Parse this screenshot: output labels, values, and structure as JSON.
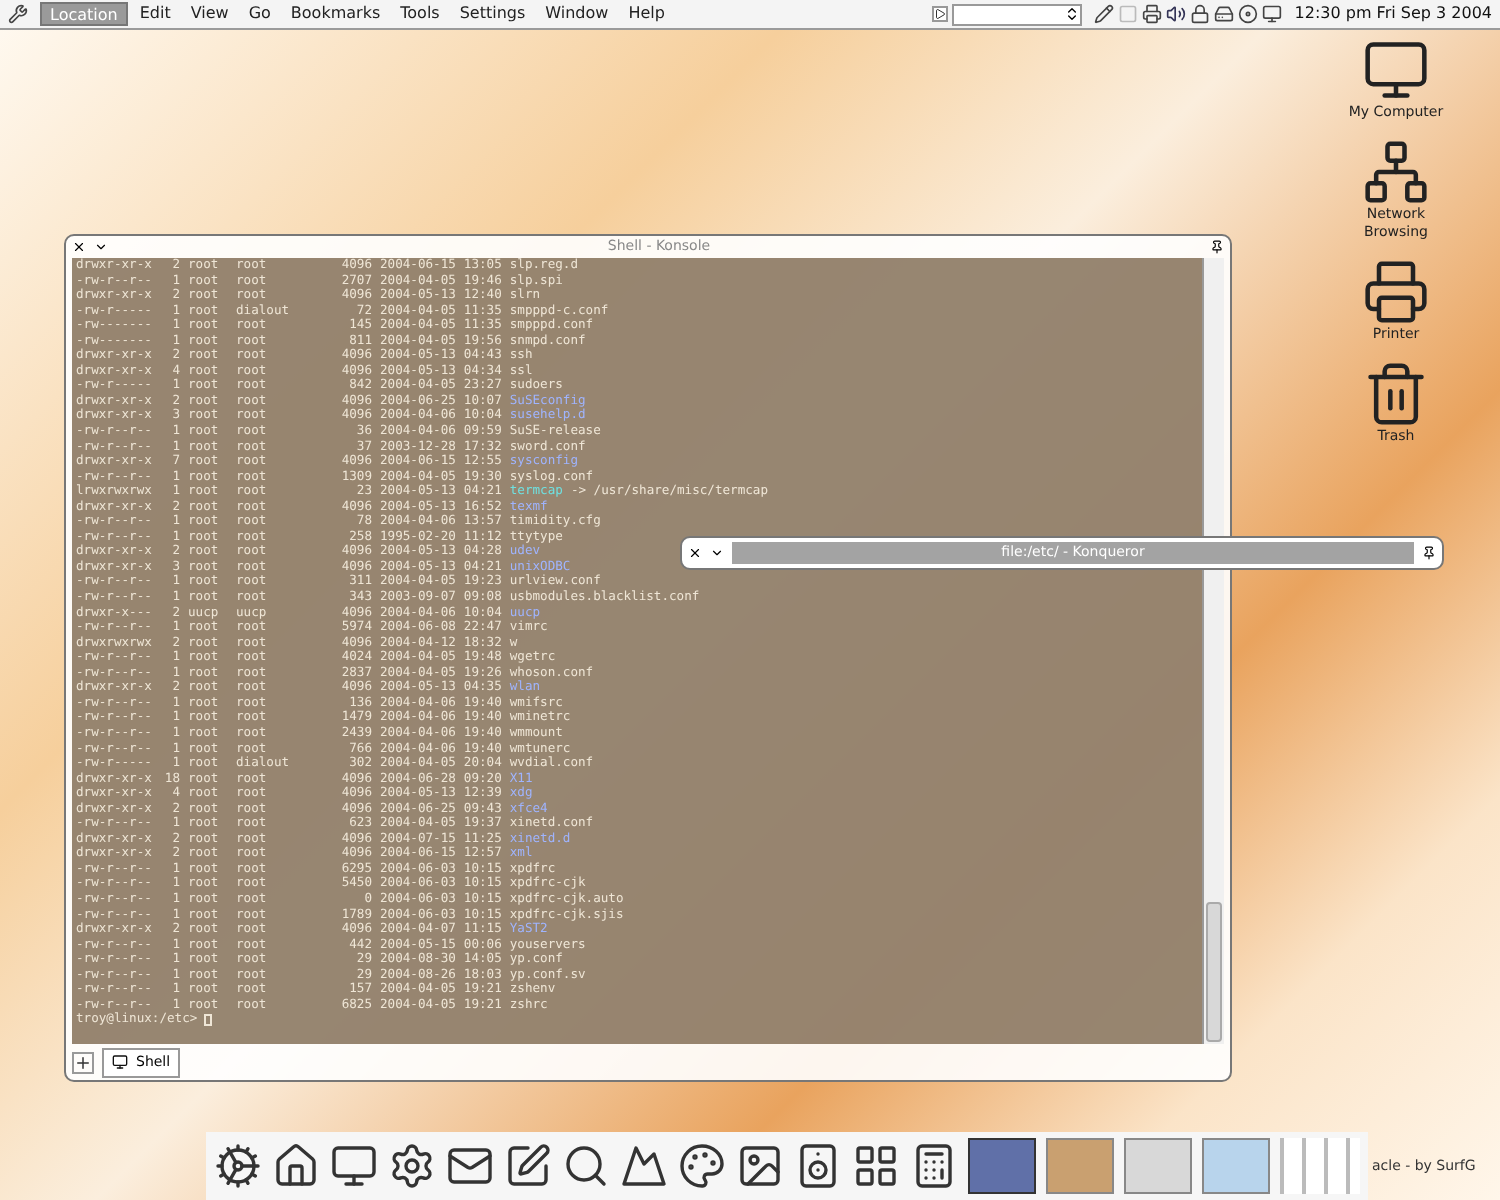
{
  "menubar": {
    "menus": [
      {
        "label": "Location",
        "selected": true
      },
      {
        "label": "Edit",
        "selected": false
      },
      {
        "label": "View",
        "selected": false
      },
      {
        "label": "Go",
        "selected": false
      },
      {
        "label": "Bookmarks",
        "selected": false
      },
      {
        "label": "Tools",
        "selected": false
      },
      {
        "label": "Settings",
        "selected": false
      },
      {
        "label": "Window",
        "selected": false
      },
      {
        "label": "Help",
        "selected": false
      }
    ],
    "clock": "12:30 pm Fri Sep 3 2004"
  },
  "desktop_icons": [
    {
      "label": "My Computer",
      "kind": "computer"
    },
    {
      "label": "Network Browsing",
      "kind": "network"
    },
    {
      "label": "Printer",
      "kind": "printer"
    },
    {
      "label": "Trash",
      "kind": "trash"
    }
  ],
  "shell_window": {
    "title": "Shell - Konsole",
    "listing": [
      {
        "perms": "drwxr-xr-x",
        "links": "2",
        "owner": "root",
        "group": "root",
        "size": "4096",
        "date": "2004-06-15",
        "time": "13:05",
        "name": "slp.reg.d",
        "kind": "file"
      },
      {
        "perms": "-rw-r--r--",
        "links": "1",
        "owner": "root",
        "group": "root",
        "size": "2707",
        "date": "2004-04-05",
        "time": "19:46",
        "name": "slp.spi",
        "kind": "file"
      },
      {
        "perms": "drwxr-xr-x",
        "links": "2",
        "owner": "root",
        "group": "root",
        "size": "4096",
        "date": "2004-05-13",
        "time": "12:40",
        "name": "slrn",
        "kind": "file"
      },
      {
        "perms": "-rw-r-----",
        "links": "1",
        "owner": "root",
        "group": "dialout",
        "size": "72",
        "date": "2004-04-05",
        "time": "11:35",
        "name": "smpppd-c.conf",
        "kind": "file"
      },
      {
        "perms": "-rw-------",
        "links": "1",
        "owner": "root",
        "group": "root",
        "size": "145",
        "date": "2004-04-05",
        "time": "11:35",
        "name": "smpppd.conf",
        "kind": "file"
      },
      {
        "perms": "-rw-------",
        "links": "1",
        "owner": "root",
        "group": "root",
        "size": "811",
        "date": "2004-04-05",
        "time": "19:56",
        "name": "snmpd.conf",
        "kind": "file"
      },
      {
        "perms": "drwxr-xr-x",
        "links": "2",
        "owner": "root",
        "group": "root",
        "size": "4096",
        "date": "2004-05-13",
        "time": "04:43",
        "name": "ssh",
        "kind": "file"
      },
      {
        "perms": "drwxr-xr-x",
        "links": "4",
        "owner": "root",
        "group": "root",
        "size": "4096",
        "date": "2004-05-13",
        "time": "04:34",
        "name": "ssl",
        "kind": "file"
      },
      {
        "perms": "-rw-r-----",
        "links": "1",
        "owner": "root",
        "group": "root",
        "size": "842",
        "date": "2004-04-05",
        "time": "23:27",
        "name": "sudoers",
        "kind": "file"
      },
      {
        "perms": "drwxr-xr-x",
        "links": "2",
        "owner": "root",
        "group": "root",
        "size": "4096",
        "date": "2004-06-25",
        "time": "10:07",
        "name": "SuSEconfig",
        "kind": "dir"
      },
      {
        "perms": "drwxr-xr-x",
        "links": "3",
        "owner": "root",
        "group": "root",
        "size": "4096",
        "date": "2004-04-06",
        "time": "10:04",
        "name": "susehelp.d",
        "kind": "dir"
      },
      {
        "perms": "-rw-r--r--",
        "links": "1",
        "owner": "root",
        "group": "root",
        "size": "36",
        "date": "2004-04-06",
        "time": "09:59",
        "name": "SuSE-release",
        "kind": "file"
      },
      {
        "perms": "-rw-r--r--",
        "links": "1",
        "owner": "root",
        "group": "root",
        "size": "37",
        "date": "2003-12-28",
        "time": "17:32",
        "name": "sword.conf",
        "kind": "file"
      },
      {
        "perms": "drwxr-xr-x",
        "links": "7",
        "owner": "root",
        "group": "root",
        "size": "4096",
        "date": "2004-06-15",
        "time": "12:55",
        "name": "sysconfig",
        "kind": "dir"
      },
      {
        "perms": "-rw-r--r--",
        "links": "1",
        "owner": "root",
        "group": "root",
        "size": "1309",
        "date": "2004-04-05",
        "time": "19:30",
        "name": "syslog.conf",
        "kind": "file"
      },
      {
        "perms": "lrwxrwxrwx",
        "links": "1",
        "owner": "root",
        "group": "root",
        "size": "23",
        "date": "2004-05-13",
        "time": "04:21",
        "name": "termcap",
        "target": "-> /usr/share/misc/termcap",
        "kind": "link"
      },
      {
        "perms": "drwxr-xr-x",
        "links": "2",
        "owner": "root",
        "group": "root",
        "size": "4096",
        "date": "2004-05-13",
        "time": "16:52",
        "name": "texmf",
        "kind": "dir"
      },
      {
        "perms": "-rw-r--r--",
        "links": "1",
        "owner": "root",
        "group": "root",
        "size": "78",
        "date": "2004-04-06",
        "time": "13:57",
        "name": "timidity.cfg",
        "kind": "file"
      },
      {
        "perms": "-rw-r--r--",
        "links": "1",
        "owner": "root",
        "group": "root",
        "size": "258",
        "date": "1995-02-20",
        "time": "11:12",
        "name": "ttytype",
        "kind": "file"
      },
      {
        "perms": "drwxr-xr-x",
        "links": "2",
        "owner": "root",
        "group": "root",
        "size": "4096",
        "date": "2004-05-13",
        "time": "04:28",
        "name": "udev",
        "kind": "dir"
      },
      {
        "perms": "drwxr-xr-x",
        "links": "3",
        "owner": "root",
        "group": "root",
        "size": "4096",
        "date": "2004-05-13",
        "time": "04:21",
        "name": "unixODBC",
        "kind": "dir"
      },
      {
        "perms": "-rw-r--r--",
        "links": "1",
        "owner": "root",
        "group": "root",
        "size": "311",
        "date": "2004-04-05",
        "time": "19:23",
        "name": "urlview.conf",
        "kind": "file"
      },
      {
        "perms": "-rw-r--r--",
        "links": "1",
        "owner": "root",
        "group": "root",
        "size": "343",
        "date": "2003-09-07",
        "time": "09:08",
        "name": "usbmodules.blacklist.conf",
        "kind": "file"
      },
      {
        "perms": "drwxr-x---",
        "links": "2",
        "owner": "uucp",
        "group": "uucp",
        "size": "4096",
        "date": "2004-04-06",
        "time": "10:04",
        "name": "uucp",
        "kind": "dir"
      },
      {
        "perms": "-rw-r--r--",
        "links": "1",
        "owner": "root",
        "group": "root",
        "size": "5974",
        "date": "2004-06-08",
        "time": "22:47",
        "name": "vimrc",
        "kind": "file"
      },
      {
        "perms": "drwxrwxrwx",
        "links": "2",
        "owner": "root",
        "group": "root",
        "size": "4096",
        "date": "2004-04-12",
        "time": "18:32",
        "name": "w",
        "kind": "file"
      },
      {
        "perms": "-rw-r--r--",
        "links": "1",
        "owner": "root",
        "group": "root",
        "size": "4024",
        "date": "2004-04-05",
        "time": "19:48",
        "name": "wgetrc",
        "kind": "file"
      },
      {
        "perms": "-rw-r--r--",
        "links": "1",
        "owner": "root",
        "group": "root",
        "size": "2837",
        "date": "2004-04-05",
        "time": "19:26",
        "name": "whoson.conf",
        "kind": "file"
      },
      {
        "perms": "drwxr-xr-x",
        "links": "2",
        "owner": "root",
        "group": "root",
        "size": "4096",
        "date": "2004-05-13",
        "time": "04:35",
        "name": "wlan",
        "kind": "dir"
      },
      {
        "perms": "-rw-r--r--",
        "links": "1",
        "owner": "root",
        "group": "root",
        "size": "136",
        "date": "2004-04-06",
        "time": "19:40",
        "name": "wmifsrc",
        "kind": "file"
      },
      {
        "perms": "-rw-r--r--",
        "links": "1",
        "owner": "root",
        "group": "root",
        "size": "1479",
        "date": "2004-04-06",
        "time": "19:40",
        "name": "wminetrc",
        "kind": "file"
      },
      {
        "perms": "-rw-r--r--",
        "links": "1",
        "owner": "root",
        "group": "root",
        "size": "2439",
        "date": "2004-04-06",
        "time": "19:40",
        "name": "wmmount",
        "kind": "file"
      },
      {
        "perms": "-rw-r--r--",
        "links": "1",
        "owner": "root",
        "group": "root",
        "size": "766",
        "date": "2004-04-06",
        "time": "19:40",
        "name": "wmtunerc",
        "kind": "file"
      },
      {
        "perms": "-rw-r-----",
        "links": "1",
        "owner": "root",
        "group": "dialout",
        "size": "302",
        "date": "2004-04-05",
        "time": "20:04",
        "name": "wvdial.conf",
        "kind": "file"
      },
      {
        "perms": "drwxr-xr-x",
        "links": "18",
        "owner": "root",
        "group": "root",
        "size": "4096",
        "date": "2004-06-28",
        "time": "09:20",
        "name": "X11",
        "kind": "dir"
      },
      {
        "perms": "drwxr-xr-x",
        "links": "4",
        "owner": "root",
        "group": "root",
        "size": "4096",
        "date": "2004-05-13",
        "time": "12:39",
        "name": "xdg",
        "kind": "dir"
      },
      {
        "perms": "drwxr-xr-x",
        "links": "2",
        "owner": "root",
        "group": "root",
        "size": "4096",
        "date": "2004-06-25",
        "time": "09:43",
        "name": "xfce4",
        "kind": "dir"
      },
      {
        "perms": "-rw-r--r--",
        "links": "1",
        "owner": "root",
        "group": "root",
        "size": "623",
        "date": "2004-04-05",
        "time": "19:37",
        "name": "xinetd.conf",
        "kind": "file"
      },
      {
        "perms": "drwxr-xr-x",
        "links": "2",
        "owner": "root",
        "group": "root",
        "size": "4096",
        "date": "2004-07-15",
        "time": "11:25",
        "name": "xinetd.d",
        "kind": "dir"
      },
      {
        "perms": "drwxr-xr-x",
        "links": "2",
        "owner": "root",
        "group": "root",
        "size": "4096",
        "date": "2004-06-15",
        "time": "12:57",
        "name": "xml",
        "kind": "dir"
      },
      {
        "perms": "-rw-r--r--",
        "links": "1",
        "owner": "root",
        "group": "root",
        "size": "6295",
        "date": "2004-06-03",
        "time": "10:15",
        "name": "xpdfrc",
        "kind": "file"
      },
      {
        "perms": "-rw-r--r--",
        "links": "1",
        "owner": "root",
        "group": "root",
        "size": "5450",
        "date": "2004-06-03",
        "time": "10:15",
        "name": "xpdfrc-cjk",
        "kind": "file"
      },
      {
        "perms": "-rw-r--r--",
        "links": "1",
        "owner": "root",
        "group": "root",
        "size": "0",
        "date": "2004-06-03",
        "time": "10:15",
        "name": "xpdfrc-cjk.auto",
        "kind": "file"
      },
      {
        "perms": "-rw-r--r--",
        "links": "1",
        "owner": "root",
        "group": "root",
        "size": "1789",
        "date": "2004-06-03",
        "time": "10:15",
        "name": "xpdfrc-cjk.sjis",
        "kind": "file"
      },
      {
        "perms": "drwxr-xr-x",
        "links": "2",
        "owner": "root",
        "group": "root",
        "size": "4096",
        "date": "2004-04-07",
        "time": "11:15",
        "name": "YaST2",
        "kind": "dir"
      },
      {
        "perms": "-rw-r--r--",
        "links": "1",
        "owner": "root",
        "group": "root",
        "size": "442",
        "date": "2004-05-15",
        "time": "00:06",
        "name": "youservers",
        "kind": "file"
      },
      {
        "perms": "-rw-r--r--",
        "links": "1",
        "owner": "root",
        "group": "root",
        "size": "29",
        "date": "2004-08-30",
        "time": "14:05",
        "name": "yp.conf",
        "kind": "file"
      },
      {
        "perms": "-rw-r--r--",
        "links": "1",
        "owner": "root",
        "group": "root",
        "size": "29",
        "date": "2004-08-26",
        "time": "18:03",
        "name": "yp.conf.sv",
        "kind": "file"
      },
      {
        "perms": "-rw-r--r--",
        "links": "1",
        "owner": "root",
        "group": "root",
        "size": "157",
        "date": "2004-04-05",
        "time": "19:21",
        "name": "zshenv",
        "kind": "file"
      },
      {
        "perms": "-rw-r--r--",
        "links": "1",
        "owner": "root",
        "group": "root",
        "size": "6825",
        "date": "2004-04-05",
        "time": "19:21",
        "name": "zshrc",
        "kind": "file"
      }
    ],
    "prompt": "troy@linux:/etc>",
    "tabs": [
      {
        "label": "Shell",
        "selected": true
      }
    ]
  },
  "konqueror_window": {
    "title": "file:/etc/ - Konqueror"
  },
  "taskbar": {
    "launchers": [
      {
        "kind": "cog"
      },
      {
        "kind": "home"
      },
      {
        "kind": "monitor"
      },
      {
        "kind": "settings"
      },
      {
        "kind": "mail"
      },
      {
        "kind": "editor"
      },
      {
        "kind": "search"
      },
      {
        "kind": "mountain"
      },
      {
        "kind": "palette"
      },
      {
        "kind": "image"
      },
      {
        "kind": "speaker"
      },
      {
        "kind": "grid"
      },
      {
        "kind": "calculator"
      }
    ],
    "caption": "acle - by SurfG"
  }
}
